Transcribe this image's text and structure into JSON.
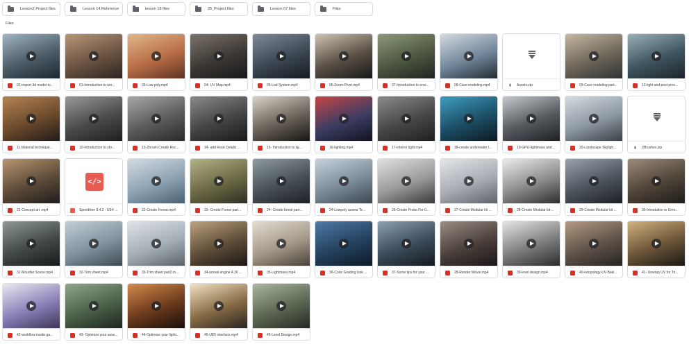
{
  "folders": [
    {
      "name": "Lesson2 Project files"
    },
    {
      "name": "Lesson 14 Reference"
    },
    {
      "name": "lesson 16 files"
    },
    {
      "name": "25_Project files"
    },
    {
      "name": "Lesson 07 files"
    },
    {
      "name": "Files"
    }
  ],
  "section_label": "Files",
  "files": [
    {
      "name": "02-import 3d model to...",
      "kind": "video",
      "colors": [
        "#9fb4c2",
        "#4d5c67",
        "#1d2730"
      ]
    },
    {
      "name": "01-Introduction to unr...",
      "kind": "video",
      "colors": [
        "#b79878",
        "#6b5342",
        "#2d2520"
      ]
    },
    {
      "name": "03-Low poly.mp4",
      "kind": "video",
      "colors": [
        "#e0b78a",
        "#b86d45",
        "#5d3324"
      ]
    },
    {
      "name": "04- UV Map.mp4",
      "kind": "video",
      "colors": [
        "#7a746b",
        "#3c3833",
        "#17191b"
      ]
    },
    {
      "name": "05-Lod System.mp4",
      "kind": "video",
      "colors": [
        "#7f8b98",
        "#3b4752",
        "#161b21"
      ]
    },
    {
      "name": "06-Zoom-Pivot.mp4",
      "kind": "video",
      "colors": [
        "#cfc3b3",
        "#594f45",
        "#181818"
      ]
    },
    {
      "name": "07-Introduction to envi...",
      "kind": "video",
      "colors": [
        "#8d9a78",
        "#4c5740",
        "#202320"
      ]
    },
    {
      "name": "08-Cave modeling.mp4",
      "kind": "video",
      "colors": [
        "#d4dbe3",
        "#718699",
        "#232c36"
      ]
    },
    {
      "name": "Assets.zip",
      "kind": "zip",
      "colors": []
    },
    {
      "name": "09-Cave modeling part...",
      "kind": "video",
      "colors": [
        "#c5b8a3",
        "#6e6658",
        "#2e3236"
      ]
    },
    {
      "name": "10-light and post proc...",
      "kind": "video",
      "colors": [
        "#9ab0b8",
        "#3e5560",
        "#1e2328"
      ]
    },
    {
      "name": "11-Material technique...",
      "kind": "video",
      "colors": [
        "#b58454",
        "#6c4a2c",
        "#201c1a"
      ]
    },
    {
      "name": "12-Introduction to zbr...",
      "kind": "video",
      "colors": [
        "#999999",
        "#4a4a4a",
        "#1f1f1f"
      ]
    },
    {
      "name": "13-Zbrush Create Roc...",
      "kind": "video",
      "colors": [
        "#a7a7a7",
        "#5b5b5b",
        "#2a2a2a"
      ]
    },
    {
      "name": "14- add Rock Details ...",
      "kind": "video",
      "colors": [
        "#8a8a8a",
        "#444444",
        "#1a1a1a"
      ]
    },
    {
      "name": "15- Introduction to lig...",
      "kind": "video",
      "colors": [
        "#d8d2c8",
        "#6a6158",
        "#171513"
      ]
    },
    {
      "name": "16-lighting.mp4",
      "kind": "video",
      "colors": [
        "#c54545",
        "#3c3d62",
        "#12131f"
      ]
    },
    {
      "name": "17-interior light.mp4",
      "kind": "video",
      "colors": [
        "#8b8b8b",
        "#474747",
        "#1f1f1f"
      ]
    },
    {
      "name": "18-create underwater l...",
      "kind": "video",
      "colors": [
        "#3e9dc0",
        "#1c4e66",
        "#0d1a22"
      ]
    },
    {
      "name": "19-GPU-lightmass and...",
      "kind": "video",
      "colors": [
        "#c5c8cc",
        "#56595e",
        "#1e2024"
      ]
    },
    {
      "name": "20-Landscape Skyligh...",
      "kind": "video",
      "colors": [
        "#d5dbe0",
        "#8d98a2",
        "#3d4148"
      ]
    },
    {
      "name": "ZBrushes.zip",
      "kind": "zip",
      "colors": []
    },
    {
      "name": "21-Concept art .mp4",
      "kind": "video",
      "colors": [
        "#b69672",
        "#5d4a38",
        "#1e1e1e"
      ]
    },
    {
      "name": "Speedtree 8.4.2 - UE4 ...",
      "kind": "code",
      "colors": []
    },
    {
      "name": "22-Create Forest.mp4",
      "kind": "video",
      "colors": [
        "#d3dbe3",
        "#8da3b3",
        "#4b5f6f"
      ]
    },
    {
      "name": "23- Create Forest part...",
      "kind": "video",
      "colors": [
        "#b3b187",
        "#6b6a44",
        "#2d2f23"
      ]
    },
    {
      "name": "24- Create forest part...",
      "kind": "video",
      "colors": [
        "#8e9aa2",
        "#475056",
        "#1c2024"
      ]
    },
    {
      "name": "24-Lowpoly assets Te...",
      "kind": "video",
      "colors": [
        "#c6d2dc",
        "#7b8c98",
        "#3c464f"
      ]
    },
    {
      "name": "26-Create Probs For 0...",
      "kind": "video",
      "colors": [
        "#e0e0e0",
        "#9a9a9a",
        "#3a3a3a"
      ]
    },
    {
      "name": "27-Create Modular kit ...",
      "kind": "video",
      "colors": [
        "#e3e6ea",
        "#a8adb3",
        "#5f6369"
      ]
    },
    {
      "name": "28-Create Modular kit-...",
      "kind": "video",
      "colors": [
        "#ebebeb",
        "#8c8c8c",
        "#2d2d2d"
      ]
    },
    {
      "name": "29-Create Modular kit ...",
      "kind": "video",
      "colors": [
        "#9aa3ad",
        "#4b535c",
        "#1d2024"
      ]
    },
    {
      "name": "30-Introdution to Unre...",
      "kind": "video",
      "colors": [
        "#9c8c7a",
        "#4f4438",
        "#1e1c1b"
      ]
    },
    {
      "name": "31-Moudlar Scene.mp4",
      "kind": "video",
      "colors": [
        "#8f9895",
        "#414946",
        "#181b1a"
      ]
    },
    {
      "name": "32-Trim sheet.mp4",
      "kind": "video",
      "colors": [
        "#c3ced5",
        "#80939f",
        "#3f4a52"
      ]
    },
    {
      "name": "33-Trim sheet part2.m...",
      "kind": "video",
      "colors": [
        "#dfe4e8",
        "#a4aeb6",
        "#5c6369"
      ]
    },
    {
      "name": "34-unreal engine 4.26 ...",
      "kind": "video",
      "colors": [
        "#bda37f",
        "#5e4c38",
        "#1b1815"
      ]
    },
    {
      "name": "35-Lightmass.mp4",
      "kind": "video",
      "colors": [
        "#e4ddd3",
        "#a49888",
        "#4a433a"
      ]
    },
    {
      "name": "36-Color Grading look ...",
      "kind": "video",
      "colors": [
        "#4f79a6",
        "#24415e",
        "#0e1824"
      ]
    },
    {
      "name": "37-Some tips for your ...",
      "kind": "video",
      "colors": [
        "#8ba0b3",
        "#3a4b5a",
        "#14191e"
      ]
    },
    {
      "name": "28-Render Movie.mp4",
      "kind": "video",
      "colors": [
        "#9a8d85",
        "#4a3f3a",
        "#1a1717"
      ]
    },
    {
      "name": "39-level design.mp4",
      "kind": "video",
      "colors": [
        "#e5e5e5",
        "#7c7c7c",
        "#2c2c2c"
      ]
    },
    {
      "name": "40-retopology-UV-Baki...",
      "kind": "video",
      "colors": [
        "#b59a82",
        "#5e5248",
        "#262322"
      ]
    },
    {
      "name": "41- Unwrap UV for Tri...",
      "kind": "video",
      "colors": [
        "#d2b27e",
        "#6b5538",
        "#1a1712"
      ]
    },
    {
      "name": "42-workflow inside ga...",
      "kind": "video",
      "colors": [
        "#e8e8ef",
        "#8a7fb8",
        "#3e3558"
      ]
    },
    {
      "name": "43- Optimize your asse...",
      "kind": "video",
      "colors": [
        "#8ea58c",
        "#4b6049",
        "#1e261e"
      ]
    },
    {
      "name": "44-Optimize your lighti...",
      "kind": "video",
      "colors": [
        "#d48a4a",
        "#6b3a1c",
        "#1a0f0a"
      ]
    },
    {
      "name": "45-UE5 interface.mp4",
      "kind": "video",
      "colors": [
        "#f2e1c3",
        "#876b45",
        "#2a2420"
      ]
    },
    {
      "name": "45-Level Design.mp4",
      "kind": "video",
      "colors": [
        "#a9b69e",
        "#5b6653",
        "#252a22"
      ]
    }
  ]
}
